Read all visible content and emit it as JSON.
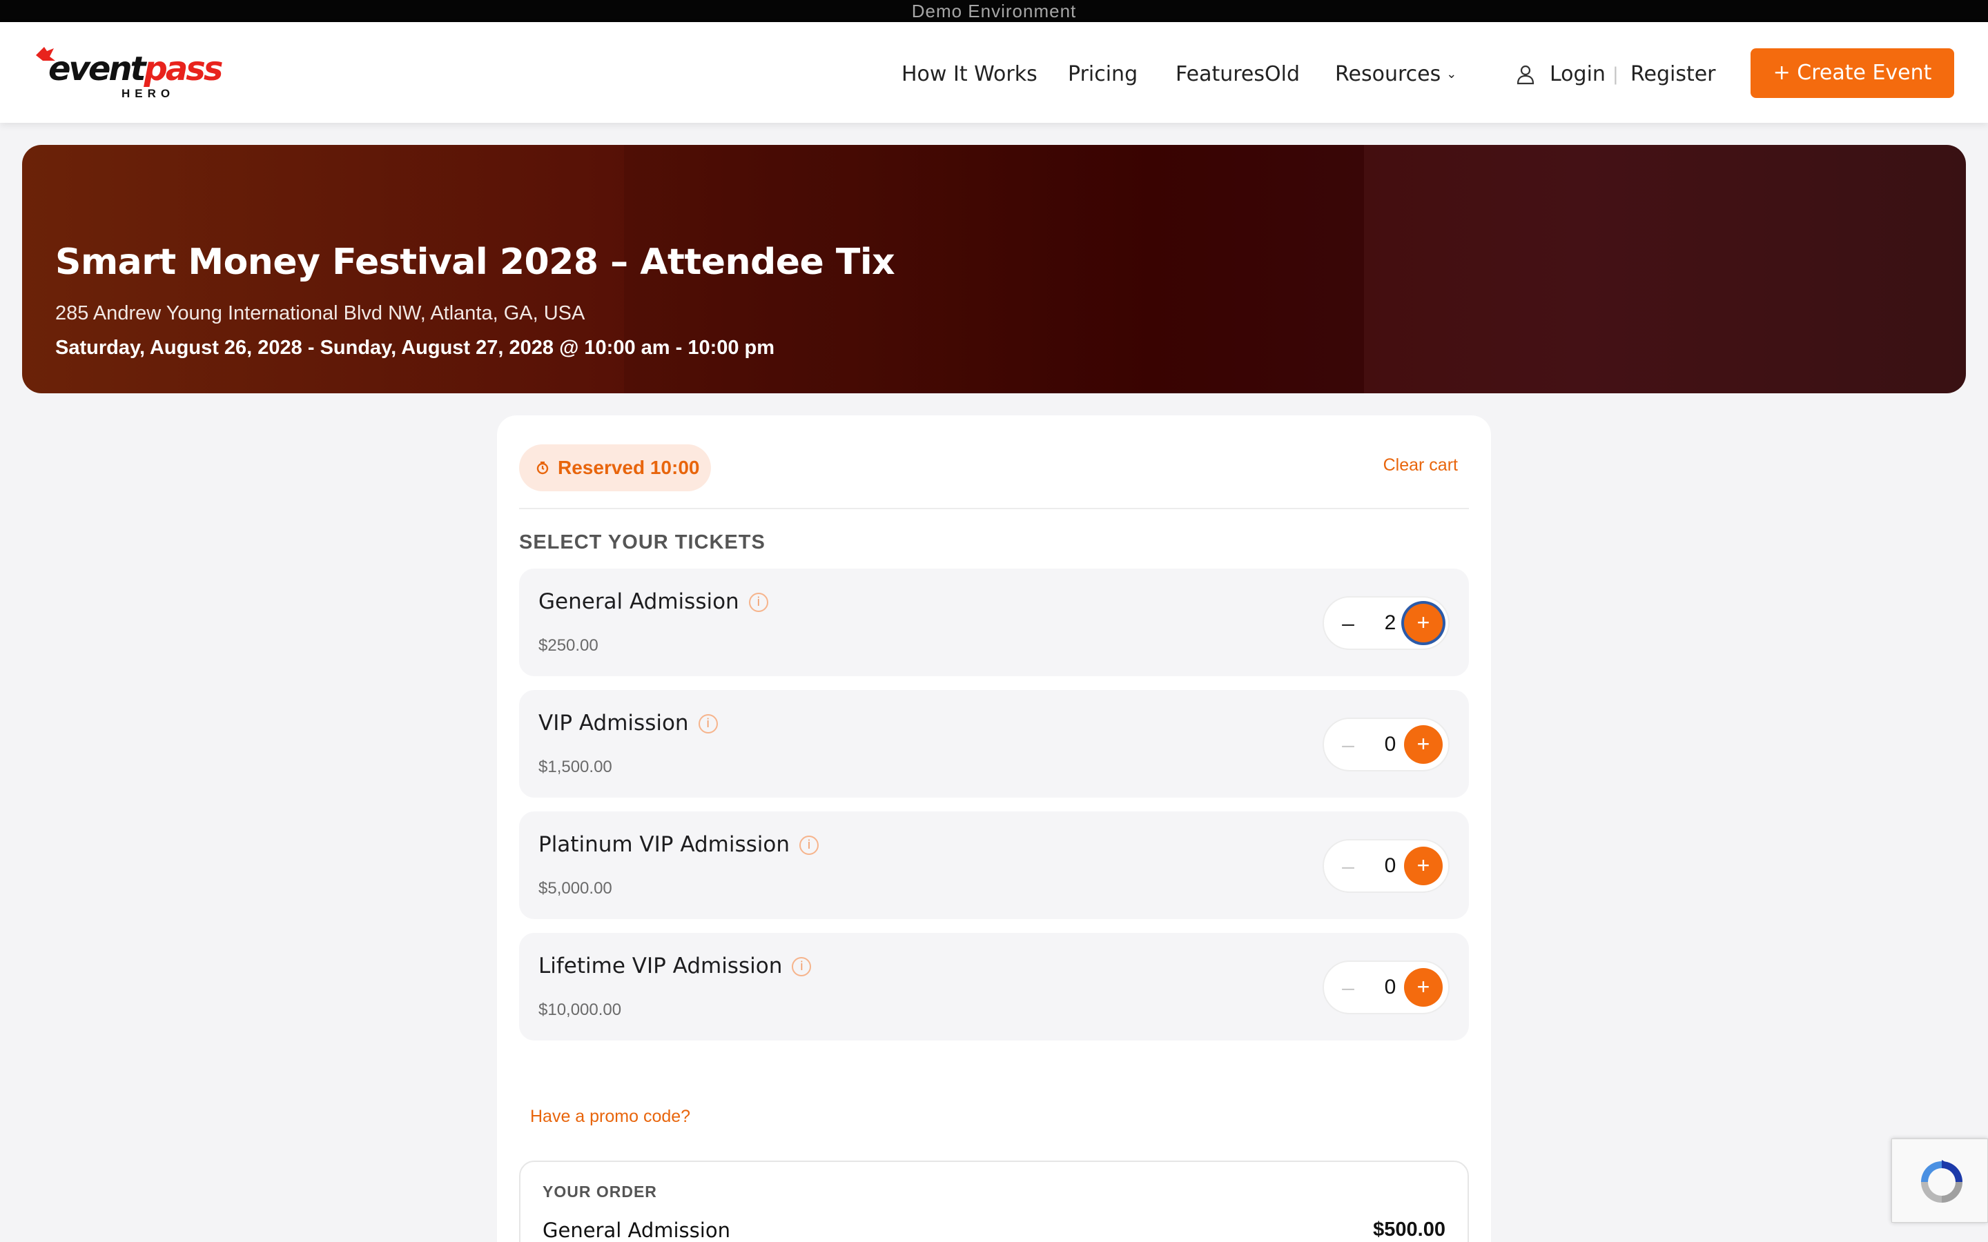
{
  "demo_banner": "Demo Environment",
  "header": {
    "logo": {
      "word_a": "event",
      "word_b": "pass",
      "sub": "HERO"
    },
    "nav": {
      "how_it_works": "How It Works",
      "pricing": "Pricing",
      "features": "FeaturesOld",
      "resources": "Resources",
      "login": "Login",
      "separator": "|",
      "register": "Register"
    },
    "create_event": "+ Create Event"
  },
  "event": {
    "title": "Smart Money Festival 2028 – Attendee Tix",
    "address": "285 Andrew Young International Blvd NW, Atlanta, GA, USA",
    "dates": "Saturday, August 26, 2028 - Sunday, August 27, 2028 @ 10:00 am - 10:00 pm"
  },
  "cart": {
    "reserved": "Reserved 10:00",
    "clear_cart": "Clear cart",
    "section_title": "SELECT YOUR TICKETS",
    "tickets": [
      {
        "name": "General Admission",
        "price": "$250.00",
        "qty": "2"
      },
      {
        "name": "VIP Admission",
        "price": "$1,500.00",
        "qty": "0"
      },
      {
        "name": "Platinum VIP Admission",
        "price": "$5,000.00",
        "qty": "0"
      },
      {
        "name": "Lifetime VIP Admission",
        "price": "$10,000.00",
        "qty": "0"
      }
    ],
    "promo": "Have a promo code?",
    "order": {
      "title": "YOUR ORDER",
      "lines": [
        {
          "name": "General Admission",
          "amount": "$500.00"
        }
      ]
    }
  },
  "icons": {
    "info": "i",
    "minus": "–",
    "plus": "+",
    "chevron": "⌄"
  },
  "colors": {
    "accent": "#f46b0e",
    "hero_dark": "#3e0402",
    "focus_ring": "#2b5aa8"
  }
}
